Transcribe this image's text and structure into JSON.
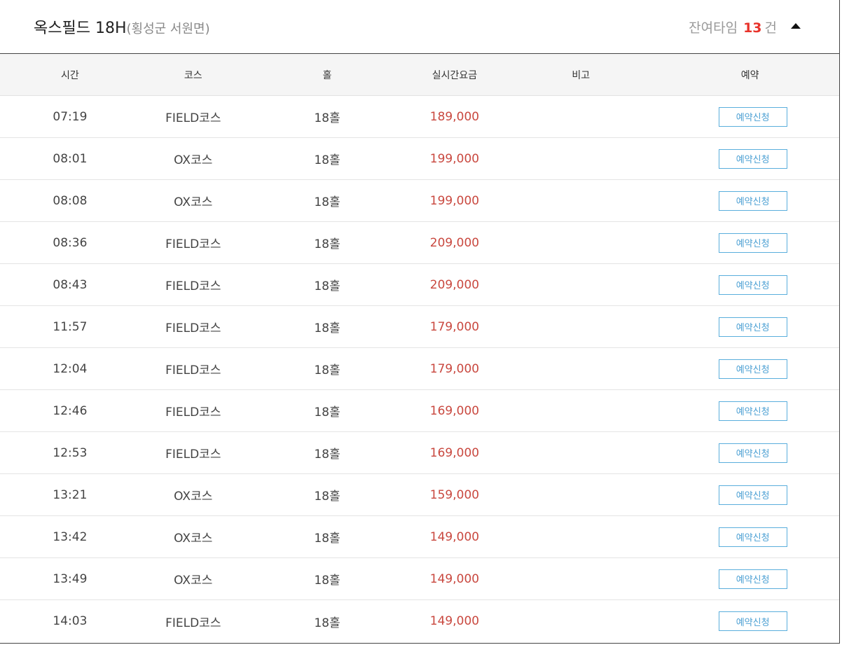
{
  "header": {
    "course_name": "옥스필드 18H",
    "location": "(횡성군 서원면)",
    "remaining_label": "잔여타임",
    "remaining_count": "13",
    "remaining_unit": "건",
    "collapse_icon": "caret-up-icon"
  },
  "columns": [
    "시간",
    "코스",
    "홀",
    "실시간요금",
    "비고",
    "예약"
  ],
  "rows": [
    {
      "time": "07:19",
      "course": "FIELD코스",
      "hole": "18홀",
      "price": "189,000",
      "note": "",
      "button": "예약신청"
    },
    {
      "time": "08:01",
      "course": "OX코스",
      "hole": "18홀",
      "price": "199,000",
      "note": "",
      "button": "예약신청"
    },
    {
      "time": "08:08",
      "course": "OX코스",
      "hole": "18홀",
      "price": "199,000",
      "note": "",
      "button": "예약신청"
    },
    {
      "time": "08:36",
      "course": "FIELD코스",
      "hole": "18홀",
      "price": "209,000",
      "note": "",
      "button": "예약신청"
    },
    {
      "time": "08:43",
      "course": "FIELD코스",
      "hole": "18홀",
      "price": "209,000",
      "note": "",
      "button": "예약신청"
    },
    {
      "time": "11:57",
      "course": "FIELD코스",
      "hole": "18홀",
      "price": "179,000",
      "note": "",
      "button": "예약신청"
    },
    {
      "time": "12:04",
      "course": "FIELD코스",
      "hole": "18홀",
      "price": "179,000",
      "note": "",
      "button": "예약신청"
    },
    {
      "time": "12:46",
      "course": "FIELD코스",
      "hole": "18홀",
      "price": "169,000",
      "note": "",
      "button": "예약신청"
    },
    {
      "time": "12:53",
      "course": "FIELD코스",
      "hole": "18홀",
      "price": "169,000",
      "note": "",
      "button": "예약신청"
    },
    {
      "time": "13:21",
      "course": "OX코스",
      "hole": "18홀",
      "price": "159,000",
      "note": "",
      "button": "예약신청"
    },
    {
      "time": "13:42",
      "course": "OX코스",
      "hole": "18홀",
      "price": "149,000",
      "note": "",
      "button": "예약신청"
    },
    {
      "time": "13:49",
      "course": "OX코스",
      "hole": "18홀",
      "price": "149,000",
      "note": "",
      "button": "예약신청"
    },
    {
      "time": "14:03",
      "course": "FIELD코스",
      "hole": "18홀",
      "price": "149,000",
      "note": "",
      "button": "예약신청"
    }
  ],
  "colors": {
    "count_red": "#e8332b",
    "price_red": "#c9483f",
    "button_blue": "#4a9fd3",
    "header_bg": "#f5f5f5"
  }
}
